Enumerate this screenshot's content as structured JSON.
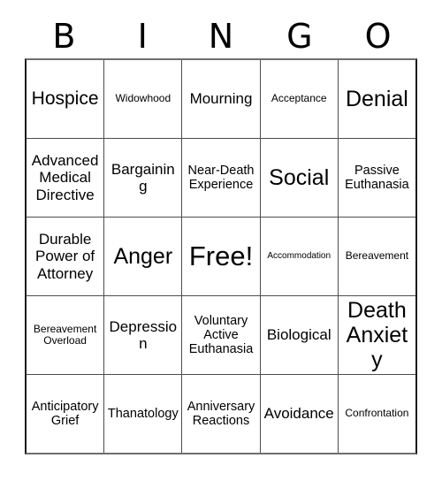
{
  "card": {
    "title": "BINGO",
    "header_letters": [
      "B",
      "I",
      "N",
      "G",
      "O"
    ],
    "rows": [
      [
        {
          "label": "Hospice",
          "size": "fs-ml"
        },
        {
          "label": "Widowhood",
          "size": "fs-xs"
        },
        {
          "label": "Mourning",
          "size": "fs-md"
        },
        {
          "label": "Acceptance",
          "size": "fs-xs"
        },
        {
          "label": "Denial",
          "size": "fs-lg"
        }
      ],
      [
        {
          "label": "Advanced Medical Directive",
          "size": "fs-md"
        },
        {
          "label": "Bargaining",
          "size": "fs-md"
        },
        {
          "label": "Near-Death Experience",
          "size": "fs-sm"
        },
        {
          "label": "Social",
          "size": "fs-lg"
        },
        {
          "label": "Passive Euthanasia",
          "size": "fs-sm"
        }
      ],
      [
        {
          "label": "Durable Power of Attorney",
          "size": "fs-md"
        },
        {
          "label": "Anger",
          "size": "fs-lg"
        },
        {
          "label": "Free!",
          "size": "fs-xl"
        },
        {
          "label": "Accommodation",
          "size": "fs-xxs"
        },
        {
          "label": "Bereavement",
          "size": "fs-xs"
        }
      ],
      [
        {
          "label": "Bereavement Overload",
          "size": "fs-xs"
        },
        {
          "label": "Depression",
          "size": "fs-md"
        },
        {
          "label": "Voluntary Active Euthanasia",
          "size": "fs-sm"
        },
        {
          "label": "Biological",
          "size": "fs-md"
        },
        {
          "label": "Death Anxiety",
          "size": "fs-lg"
        }
      ],
      [
        {
          "label": "Anticipatory Grief",
          "size": "fs-sm"
        },
        {
          "label": "Thanatology",
          "size": "fs-sm"
        },
        {
          "label": "Anniversary Reactions",
          "size": "fs-sm"
        },
        {
          "label": "Avoidance",
          "size": "fs-md"
        },
        {
          "label": "Confrontation",
          "size": "fs-xs"
        }
      ]
    ]
  },
  "colors": {
    "background": "#ffffff",
    "text": "#000000",
    "grid_border": "#4d4d4d",
    "outer_border": "#1a1a1a"
  }
}
